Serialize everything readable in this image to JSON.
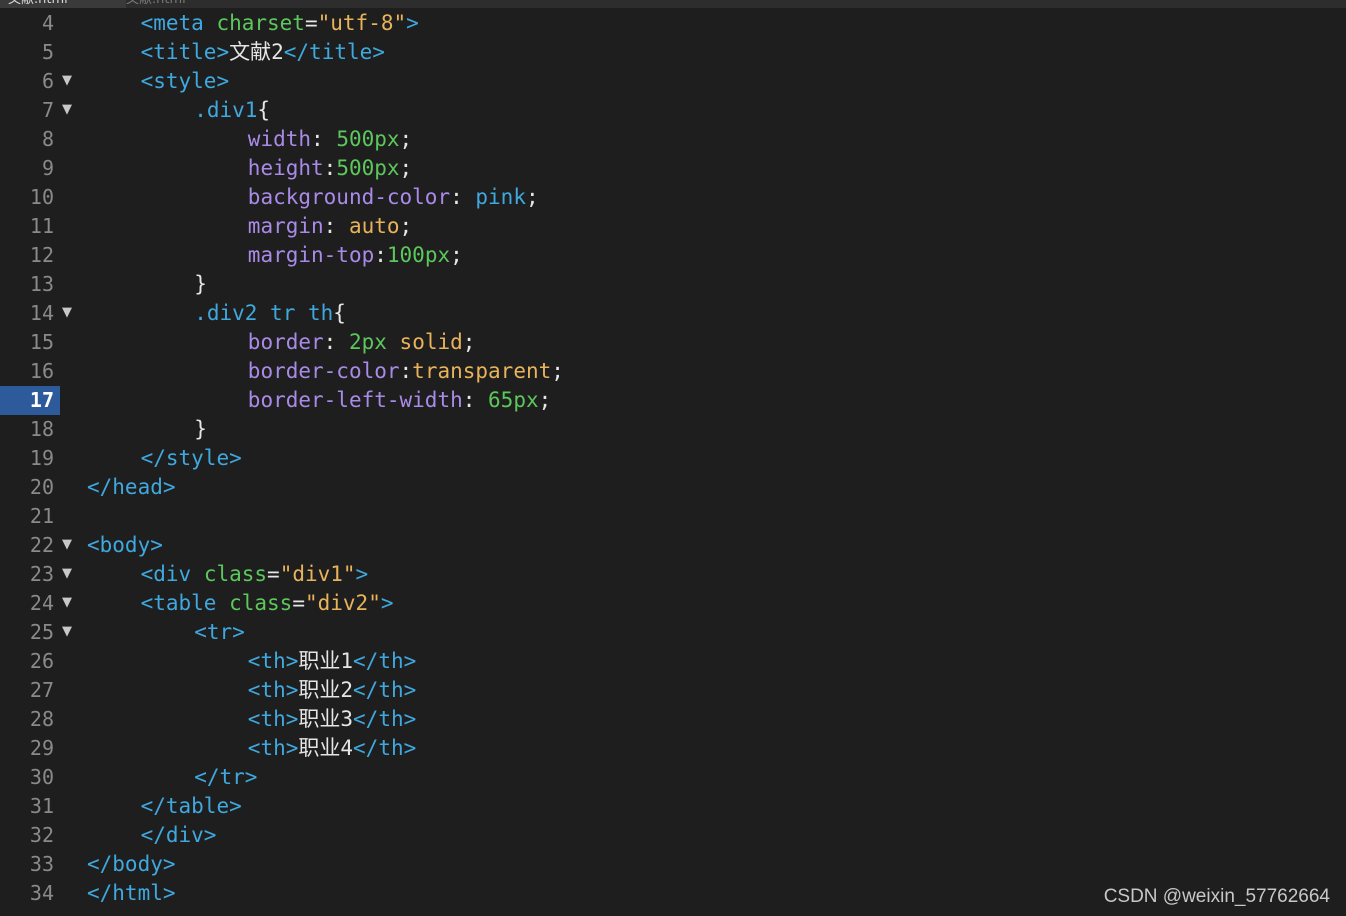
{
  "tabs": [
    {
      "label": "文献.html",
      "active": true
    },
    {
      "label": "文献.html",
      "active": false
    }
  ],
  "current_line": "17",
  "lines": [
    {
      "n": "4",
      "fold": false,
      "indent": 1,
      "tokens": [
        [
          "tag",
          "<meta "
        ],
        [
          "attr",
          "charset"
        ],
        [
          "plain",
          "="
        ],
        [
          "str",
          "\"utf-8\""
        ],
        [
          "tag",
          ">"
        ]
      ]
    },
    {
      "n": "5",
      "fold": false,
      "indent": 1,
      "tokens": [
        [
          "tag",
          "<title>"
        ],
        [
          "plain",
          "文献2"
        ],
        [
          "tag",
          "</title>"
        ]
      ]
    },
    {
      "n": "6",
      "fold": true,
      "indent": 1,
      "tokens": [
        [
          "tag",
          "<style>"
        ]
      ]
    },
    {
      "n": "7",
      "fold": true,
      "indent": 2,
      "tokens": [
        [
          "sel",
          ".div1"
        ],
        [
          "plain",
          "{"
        ]
      ]
    },
    {
      "n": "8",
      "fold": false,
      "indent": 3,
      "tokens": [
        [
          "prop",
          "width"
        ],
        [
          "plain",
          ": "
        ],
        [
          "num",
          "500px"
        ],
        [
          "plain",
          ";"
        ]
      ]
    },
    {
      "n": "9",
      "fold": false,
      "indent": 3,
      "tokens": [
        [
          "prop",
          "height"
        ],
        [
          "plain",
          ":"
        ],
        [
          "num",
          "500px"
        ],
        [
          "plain",
          ";"
        ]
      ]
    },
    {
      "n": "10",
      "fold": false,
      "indent": 3,
      "tokens": [
        [
          "prop",
          "background-color"
        ],
        [
          "plain",
          ": "
        ],
        [
          "sel",
          "pink"
        ],
        [
          "plain",
          ";"
        ]
      ]
    },
    {
      "n": "11",
      "fold": false,
      "indent": 3,
      "tokens": [
        [
          "prop",
          "margin"
        ],
        [
          "plain",
          ": "
        ],
        [
          "kw",
          "auto"
        ],
        [
          "plain",
          ";"
        ]
      ]
    },
    {
      "n": "12",
      "fold": false,
      "indent": 3,
      "tokens": [
        [
          "prop",
          "margin-top"
        ],
        [
          "plain",
          ":"
        ],
        [
          "num",
          "100px"
        ],
        [
          "plain",
          ";"
        ]
      ]
    },
    {
      "n": "13",
      "fold": false,
      "indent": 2,
      "tokens": [
        [
          "plain",
          "}"
        ]
      ]
    },
    {
      "n": "14",
      "fold": true,
      "indent": 2,
      "tokens": [
        [
          "sel",
          ".div2 tr th"
        ],
        [
          "plain",
          "{"
        ]
      ]
    },
    {
      "n": "15",
      "fold": false,
      "indent": 3,
      "tokens": [
        [
          "prop",
          "border"
        ],
        [
          "plain",
          ": "
        ],
        [
          "num",
          "2px"
        ],
        [
          "plain",
          " "
        ],
        [
          "kw",
          "solid"
        ],
        [
          "plain",
          ";"
        ]
      ]
    },
    {
      "n": "16",
      "fold": false,
      "indent": 3,
      "tokens": [
        [
          "prop",
          "border-color"
        ],
        [
          "plain",
          ":"
        ],
        [
          "kw",
          "transparent"
        ],
        [
          "plain",
          ";"
        ]
      ]
    },
    {
      "n": "17",
      "fold": false,
      "indent": 3,
      "tokens": [
        [
          "prop",
          "border-left-width"
        ],
        [
          "plain",
          ": "
        ],
        [
          "num",
          "65px"
        ],
        [
          "plain",
          ";"
        ]
      ]
    },
    {
      "n": "18",
      "fold": false,
      "indent": 2,
      "tokens": [
        [
          "plain",
          "}"
        ]
      ]
    },
    {
      "n": "19",
      "fold": false,
      "indent": 1,
      "tokens": [
        [
          "tag",
          "</style>"
        ]
      ]
    },
    {
      "n": "20",
      "fold": false,
      "indent": 0,
      "tokens": [
        [
          "tag",
          "</head>"
        ]
      ]
    },
    {
      "n": "21",
      "fold": false,
      "indent": 0,
      "tokens": []
    },
    {
      "n": "22",
      "fold": true,
      "indent": 0,
      "tokens": [
        [
          "tag",
          "<body>"
        ]
      ]
    },
    {
      "n": "23",
      "fold": true,
      "indent": 1,
      "tokens": [
        [
          "tag",
          "<div "
        ],
        [
          "attr",
          "class"
        ],
        [
          "plain",
          "="
        ],
        [
          "str",
          "\"div1\""
        ],
        [
          "tag",
          ">"
        ]
      ]
    },
    {
      "n": "24",
      "fold": true,
      "indent": 1,
      "tokens": [
        [
          "tag",
          "<table "
        ],
        [
          "attr",
          "class"
        ],
        [
          "plain",
          "="
        ],
        [
          "str",
          "\"div2\""
        ],
        [
          "tag",
          ">"
        ]
      ]
    },
    {
      "n": "25",
      "fold": true,
      "indent": 2,
      "tokens": [
        [
          "tag",
          "<tr>"
        ]
      ]
    },
    {
      "n": "26",
      "fold": false,
      "indent": 3,
      "tokens": [
        [
          "tag",
          "<th>"
        ],
        [
          "plain",
          "职业1"
        ],
        [
          "tag",
          "</th>"
        ]
      ]
    },
    {
      "n": "27",
      "fold": false,
      "indent": 3,
      "tokens": [
        [
          "tag",
          "<th>"
        ],
        [
          "plain",
          "职业2"
        ],
        [
          "tag",
          "</th>"
        ]
      ]
    },
    {
      "n": "28",
      "fold": false,
      "indent": 3,
      "tokens": [
        [
          "tag",
          "<th>"
        ],
        [
          "plain",
          "职业3"
        ],
        [
          "tag",
          "</th>"
        ]
      ]
    },
    {
      "n": "29",
      "fold": false,
      "indent": 3,
      "tokens": [
        [
          "tag",
          "<th>"
        ],
        [
          "plain",
          "职业4"
        ],
        [
          "tag",
          "</th>"
        ]
      ]
    },
    {
      "n": "30",
      "fold": false,
      "indent": 2,
      "tokens": [
        [
          "tag",
          "</tr>"
        ]
      ]
    },
    {
      "n": "31",
      "fold": false,
      "indent": 1,
      "tokens": [
        [
          "tag",
          "</table>"
        ]
      ]
    },
    {
      "n": "32",
      "fold": false,
      "indent": 1,
      "tokens": [
        [
          "tag",
          "</div>"
        ]
      ]
    },
    {
      "n": "33",
      "fold": false,
      "indent": 0,
      "tokens": [
        [
          "tag",
          "</body>"
        ]
      ]
    },
    {
      "n": "34",
      "fold": false,
      "indent": 0,
      "tokens": [
        [
          "tag",
          "</html>"
        ]
      ]
    }
  ],
  "colors": {
    "background": "#1e1e1e",
    "tag": "#3fa8df",
    "attr": "#5cc85c",
    "string": "#e8b35b",
    "property": "#a98ae8",
    "number": "#5cc85c",
    "current_line_bg": "#2d5a9b"
  },
  "icons": {
    "fold": "fold-triangle-icon"
  },
  "watermark": "CSDN @weixin_57762664"
}
